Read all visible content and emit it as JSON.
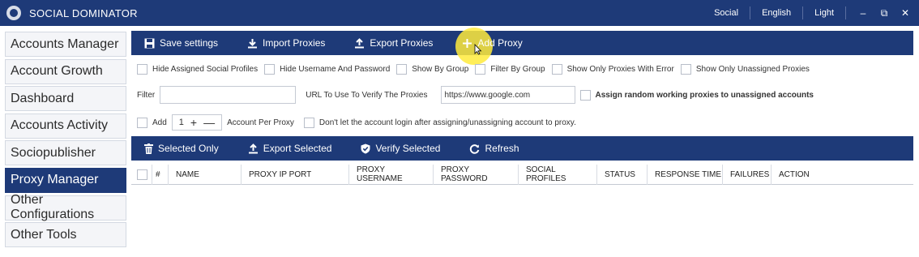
{
  "app": {
    "title": "SOCIAL DOMINATOR"
  },
  "titlebar": {
    "menus": [
      "Social",
      "English",
      "Light"
    ],
    "window_buttons": [
      "–",
      "⧉",
      "✕"
    ]
  },
  "sidebar": {
    "items": [
      {
        "label": "Accounts Manager"
      },
      {
        "label": "Account Growth"
      },
      {
        "label": "Dashboard"
      },
      {
        "label": "Accounts Activity"
      },
      {
        "label": "Sociopublisher"
      },
      {
        "label": "Proxy Manager"
      },
      {
        "label": "Other Configurations"
      },
      {
        "label": "Other Tools"
      }
    ]
  },
  "toolbar": {
    "save": "Save settings",
    "import": "Import Proxies",
    "export": "Export Proxies",
    "add": "Add Proxy"
  },
  "filters": {
    "hide_assigned": "Hide Assigned Social Profiles",
    "hide_credentials": "Hide Username And Password",
    "show_by_group": "Show By Group",
    "filter_by_group": "Filter By Group",
    "only_error": "Show Only Proxies With Error",
    "only_unassigned": "Show Only Unassigned Proxies",
    "filter_label": "Filter",
    "url_label": "URL To Use To Verify The Proxies",
    "url_value": "https://www.google.com",
    "assign_random": "Assign random working proxies to unassigned accounts",
    "add_label": "Add",
    "add_count": "1",
    "account_per_proxy": "Account Per Proxy",
    "dont_let_login": "Don't let the account login after assigning/unassigning account to proxy."
  },
  "toolbar2": {
    "selected_only": "Selected Only",
    "export_selected": "Export Selected",
    "verify_selected": "Verify Selected",
    "refresh": "Refresh"
  },
  "table": {
    "columns": [
      "#",
      "NAME",
      "PROXY IP PORT",
      "PROXY USERNAME",
      "PROXY PASSWORD",
      "SOCIAL PROFILES",
      "STATUS",
      "RESPONSE TIME",
      "FAILURES",
      "ACTION"
    ]
  },
  "colors": {
    "accent": "#1e3a78",
    "highlight": "#ffeb3c"
  }
}
